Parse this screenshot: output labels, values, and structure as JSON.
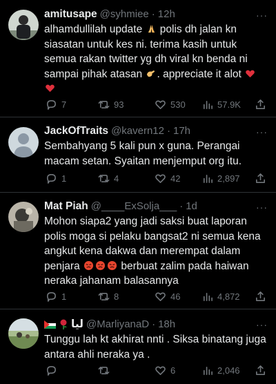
{
  "tweets": [
    {
      "name": "amitusape",
      "handle": "@syhmiee",
      "time": "12h",
      "line1a": "alhamdullilah update ",
      "line1b": " polis dh jalan kn",
      "line2": "siasatan untuk kes ni. terima kasih untuk",
      "line3": "semua rakan twitter yg dh viral kn benda ni",
      "line4a": "sampai pihak atasan ",
      "line4b": ". appreciate it alot ",
      "replies": "7",
      "retweets": "93",
      "likes": "530",
      "views": "57.9K"
    },
    {
      "name": "JackOfTraits",
      "handle": "@kavern12",
      "time": "17h",
      "line1": "Sembahyang 5 kali pun x guna. Perangai",
      "line2": "macam setan. Syaitan menjemput org itu.",
      "replies": "1",
      "retweets": "4",
      "likes": "42",
      "views": "2,897"
    },
    {
      "name": "Mat Piah",
      "handle": "@____ExSolja___",
      "time": "1d",
      "line1": "Mohon siapa2 yang jadi saksi buat laporan",
      "line2": "polis moga si pelaku bangsat2 ni semua kena",
      "line3": "angkut kena dakwa dan merempat dalam",
      "line4a": "penjara ",
      "line4b": " berbuat zalim pada haiwan",
      "line5": "neraka jahanam balasannya",
      "replies": "1",
      "retweets": "8",
      "likes": "46",
      "views": "4,872"
    },
    {
      "name_text": "ليا",
      "handle": "@MarliyanaD",
      "time": "18h",
      "line1": "Tunggu lah kt akhirat nnti . Siksa binatang juga",
      "line2": "antara ahli neraka ya .",
      "likes": "6",
      "views": "2,046"
    }
  ],
  "dot": "·",
  "more": "···"
}
